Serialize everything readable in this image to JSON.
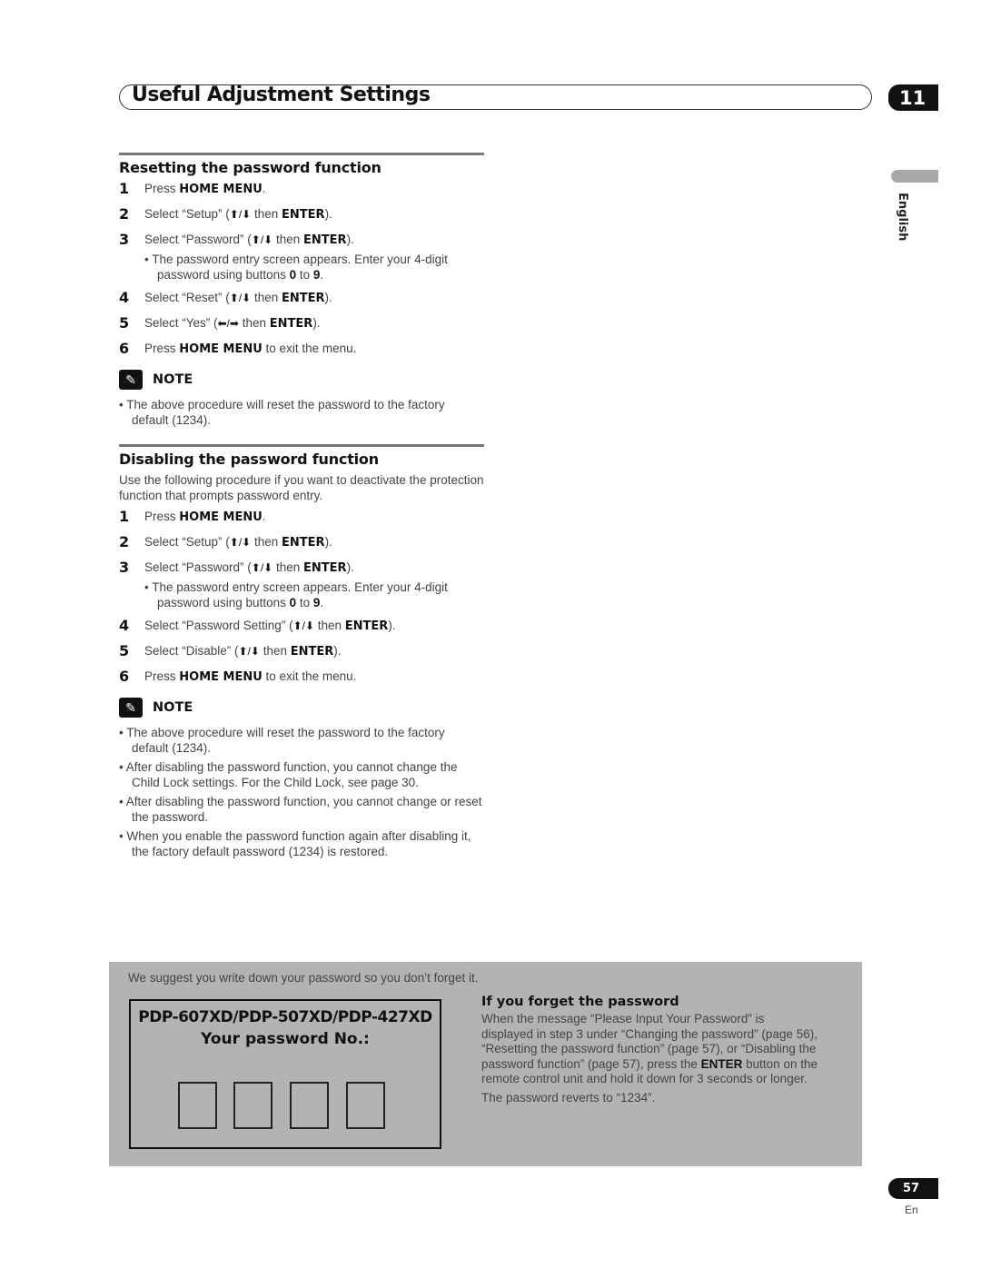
{
  "header": {
    "title": "Useful Adjustment Settings",
    "chapter": "11"
  },
  "side_tab": {
    "language": "English"
  },
  "resetting": {
    "title": "Resetting the password function",
    "steps": [
      {
        "num": "1",
        "pre": "Press ",
        "bold": "HOME MENU",
        "post": "."
      },
      {
        "num": "2",
        "pre": "Select “Setup” (",
        "arrows": "↑/↓",
        "mid": " then ",
        "bold": "ENTER",
        "post": ")."
      },
      {
        "num": "3",
        "pre": "Select “Password” (",
        "arrows": "↑/↓",
        "mid": " then ",
        "bold": "ENTER",
        "post": ")."
      },
      {
        "num": "4",
        "pre": "Select “Reset” (",
        "arrows": "↑/↓",
        "mid": " then ",
        "bold": "ENTER",
        "post": ")."
      },
      {
        "num": "5",
        "pre": "Select “Yes” (",
        "arrows": "←/→",
        "mid": " then ",
        "bold": "ENTER",
        "post": ")."
      },
      {
        "num": "6",
        "pre": "Press ",
        "bold": "HOME MENU",
        "post": " to exit the menu."
      }
    ],
    "sub_bullet": {
      "pre": "The password entry screen appears. Enter your 4-digit password using buttons ",
      "b1": "0",
      "mid": " to ",
      "b2": "9",
      "post": "."
    },
    "note_label": "NOTE",
    "notes": [
      "The above procedure will reset the password to the factory default (1234)."
    ]
  },
  "disabling": {
    "title": "Disabling the password function",
    "intro": "Use the following procedure if you want to deactivate the protection function that prompts password entry.",
    "steps": [
      {
        "num": "1",
        "pre": "Press ",
        "bold": "HOME MENU",
        "post": "."
      },
      {
        "num": "2",
        "pre": "Select “Setup” (",
        "arrows": "↑/↓",
        "mid": " then ",
        "bold": "ENTER",
        "post": ")."
      },
      {
        "num": "3",
        "pre": "Select “Password” (",
        "arrows": "↑/↓",
        "mid": " then ",
        "bold": "ENTER",
        "post": ")."
      },
      {
        "num": "4",
        "pre": "Select “Password Setting” (",
        "arrows": "↑/↓",
        "mid": " then ",
        "bold": "ENTER",
        "post": ")."
      },
      {
        "num": "5",
        "pre": "Select “Disable” (",
        "arrows": "↑/↓",
        "mid": " then ",
        "bold": "ENTER",
        "post": ")."
      },
      {
        "num": "6",
        "pre": "Press ",
        "bold": "HOME MENU",
        "post": " to exit the menu."
      }
    ],
    "sub_bullet": {
      "pre": "The password entry screen appears. Enter your 4-digit password using buttons ",
      "b1": "0",
      "mid": " to ",
      "b2": "9",
      "post": "."
    },
    "note_label": "NOTE",
    "notes": [
      "The above procedure will reset the password to the factory default (1234).",
      "After disabling the password function, you cannot change the Child Lock settings. For the Child Lock, see page 30.",
      "After disabling the password function, you cannot change or reset the password.",
      "When you enable the password function again after disabling it, the factory default password (1234) is restored."
    ]
  },
  "panel": {
    "suggest": "We suggest you write down your password so you don’t forget it.",
    "models": "PDP-607XD/PDP-507XD/PDP-427XD",
    "password_label": "Your password No.:",
    "digit_boxes": 4,
    "forget_title": "If you forget the password",
    "forget_pre": "When the message “Please Input Your Password” is displayed in step 3 under “Changing the password” (page 56), “Resetting the password function” (page 57), or “Disabling the password function” (page 57), press the ",
    "forget_bold": "ENTER",
    "forget_post": " button on the remote control unit and hold it down for 3 seconds or longer.",
    "reverts": "The password reverts to “1234”."
  },
  "footer": {
    "page": "57",
    "lang": "En"
  }
}
